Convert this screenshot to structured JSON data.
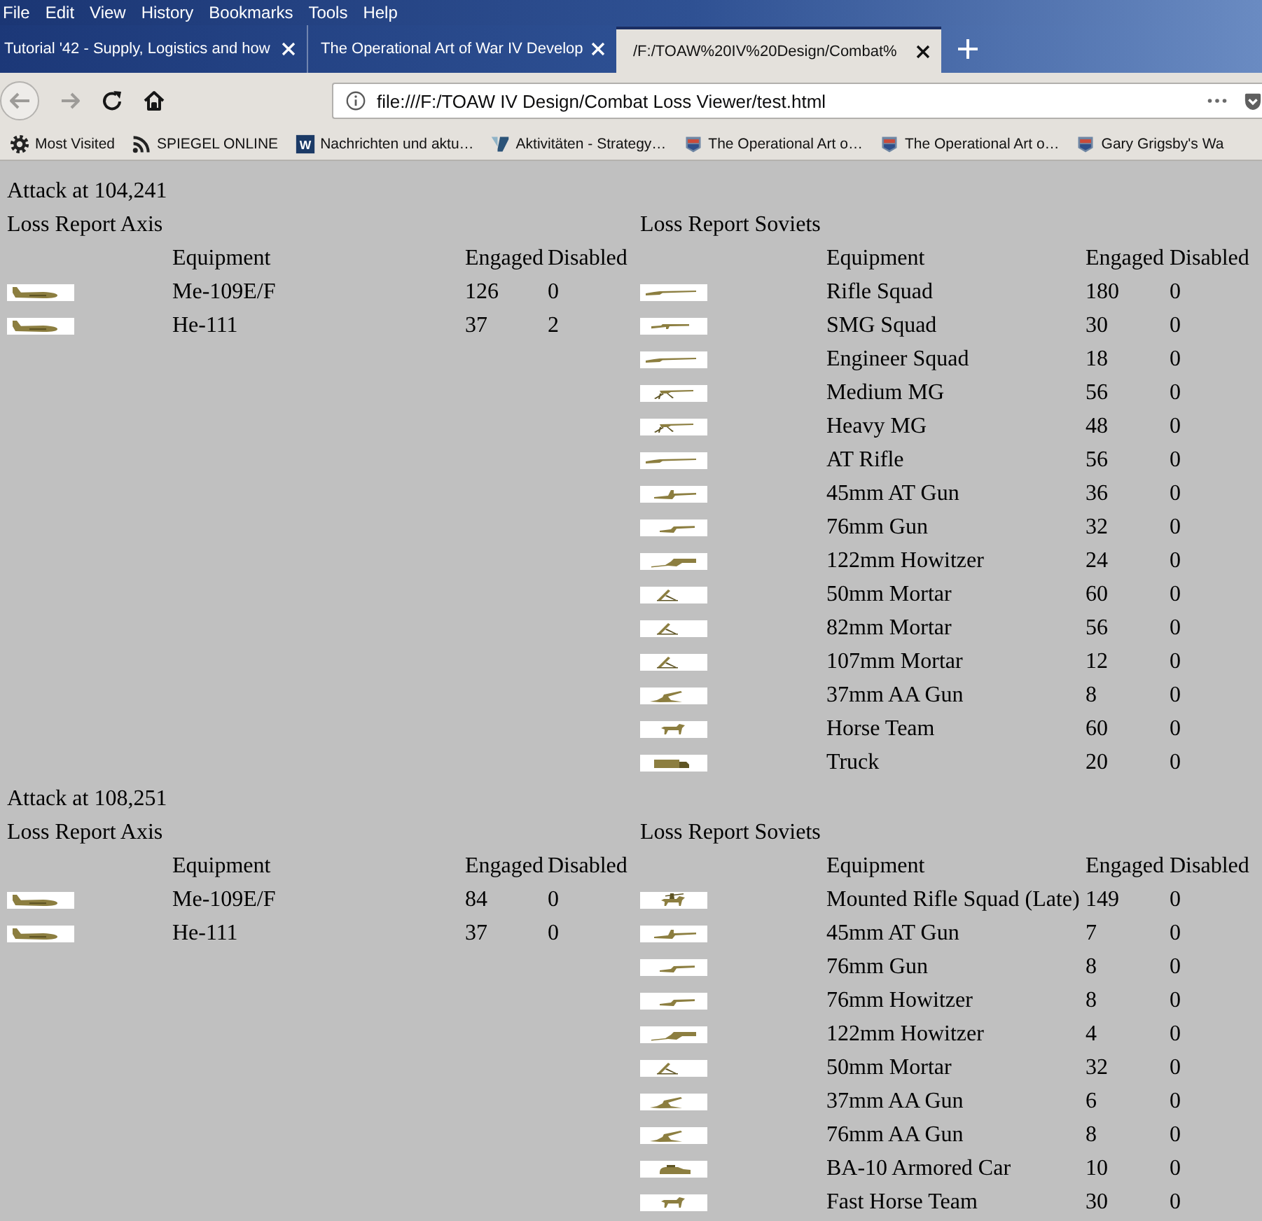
{
  "menu_bar": [
    "File",
    "Edit",
    "View",
    "History",
    "Bookmarks",
    "Tools",
    "Help"
  ],
  "tabs": [
    {
      "title": "Tutorial '42 - Supply, Logistics and how",
      "selected": false
    },
    {
      "title": "The Operational Art of War IV Develop",
      "selected": false
    },
    {
      "title": "/F:/TOAW%20IV%20Design/Combat%",
      "selected": true
    }
  ],
  "nav_buttons": [
    {
      "kind": "back",
      "disabled": true
    },
    {
      "kind": "forward",
      "disabled": true
    },
    {
      "kind": "reload",
      "disabled": false
    },
    {
      "kind": "home",
      "disabled": false
    }
  ],
  "address_bar": {
    "value": "file:///F:/TOAW IV Design/Combat Loss Viewer/test.html"
  },
  "bookmarks": [
    {
      "kind": "gear",
      "label": "Most Visited"
    },
    {
      "kind": "feed",
      "label": "SPIEGEL ONLINE"
    },
    {
      "kind": "letter",
      "logo": "W",
      "label": "Nachrichten und aktu…"
    },
    {
      "kind": "tile",
      "label": "Aktivitäten - Strategy…"
    },
    {
      "kind": "crest",
      "label": "The Operational Art o…"
    },
    {
      "kind": "crest",
      "label": "The Operational Art o…"
    },
    {
      "kind": "crest",
      "label": "Gary Grigsby's Wa"
    }
  ],
  "attacks": [
    {
      "title": "Attack at 104,241",
      "reports": [
        {
          "title": "Loss Report Axis",
          "columns": [
            "Equipment",
            "Engaged",
            "Disabled"
          ],
          "rows": [
            {
              "kind": "plane",
              "equipment": "Me-109E/F",
              "engaged_count": "126",
              "disabled_count": "0"
            },
            {
              "kind": "plane",
              "equipment": "He-111",
              "engaged_count": "37",
              "disabled_count": "2"
            }
          ]
        },
        {
          "title": "Loss Report Soviets",
          "columns": [
            "Equipment",
            "Engaged",
            "Disabled"
          ],
          "rows": [
            {
              "kind": "rifle",
              "equipment": "Rifle Squad",
              "engaged_count": "180",
              "disabled_count": "0"
            },
            {
              "kind": "smg",
              "equipment": "SMG Squad",
              "engaged_count": "30",
              "disabled_count": "0"
            },
            {
              "kind": "rifle",
              "equipment": "Engineer Squad",
              "engaged_count": "18",
              "disabled_count": "0"
            },
            {
              "kind": "mg",
              "equipment": "Medium MG",
              "engaged_count": "56",
              "disabled_count": "0"
            },
            {
              "kind": "mg",
              "equipment": "Heavy MG",
              "engaged_count": "48",
              "disabled_count": "0"
            },
            {
              "kind": "rifle",
              "equipment": "AT Rifle",
              "engaged_count": "56",
              "disabled_count": "0"
            },
            {
              "kind": "atgun",
              "equipment": "45mm AT Gun",
              "engaged_count": "36",
              "disabled_count": "0"
            },
            {
              "kind": "gun",
              "equipment": "76mm Gun",
              "engaged_count": "32",
              "disabled_count": "0"
            },
            {
              "kind": "howitzer",
              "equipment": "122mm Howitzer",
              "engaged_count": "24",
              "disabled_count": "0"
            },
            {
              "kind": "mortar",
              "equipment": "50mm Mortar",
              "engaged_count": "60",
              "disabled_count": "0"
            },
            {
              "kind": "mortar",
              "equipment": "82mm Mortar",
              "engaged_count": "56",
              "disabled_count": "0"
            },
            {
              "kind": "mortar",
              "equipment": "107mm Mortar",
              "engaged_count": "12",
              "disabled_count": "0"
            },
            {
              "kind": "aagun",
              "equipment": "37mm AA Gun",
              "engaged_count": "8",
              "disabled_count": "0"
            },
            {
              "kind": "horse",
              "equipment": "Horse Team",
              "engaged_count": "60",
              "disabled_count": "0"
            },
            {
              "kind": "truck",
              "equipment": "Truck",
              "engaged_count": "20",
              "disabled_count": "0"
            }
          ]
        }
      ]
    },
    {
      "title": "Attack at 108,251",
      "reports": [
        {
          "title": "Loss Report Axis",
          "columns": [
            "Equipment",
            "Engaged",
            "Disabled"
          ],
          "rows": [
            {
              "kind": "plane",
              "equipment": "Me-109E/F",
              "engaged_count": "84",
              "disabled_count": "0"
            },
            {
              "kind": "plane",
              "equipment": "He-111",
              "engaged_count": "37",
              "disabled_count": "0"
            }
          ]
        },
        {
          "title": "Loss Report Soviets",
          "columns": [
            "Equipment",
            "Engaged",
            "Disabled"
          ],
          "rows": [
            {
              "kind": "cavalry",
              "equipment": "Mounted Rifle Squad (Late)",
              "engaged_count": "149",
              "disabled_count": "0"
            },
            {
              "kind": "atgun",
              "equipment": "45mm AT Gun",
              "engaged_count": "7",
              "disabled_count": "0"
            },
            {
              "kind": "gun",
              "equipment": "76mm Gun",
              "engaged_count": "8",
              "disabled_count": "0"
            },
            {
              "kind": "gun",
              "equipment": "76mm Howitzer",
              "engaged_count": "8",
              "disabled_count": "0"
            },
            {
              "kind": "howitzer",
              "equipment": "122mm Howitzer",
              "engaged_count": "4",
              "disabled_count": "0"
            },
            {
              "kind": "mortar",
              "equipment": "50mm Mortar",
              "engaged_count": "32",
              "disabled_count": "0"
            },
            {
              "kind": "aagun",
              "equipment": "37mm AA Gun",
              "engaged_count": "6",
              "disabled_count": "0"
            },
            {
              "kind": "aagun",
              "equipment": "76mm AA Gun",
              "engaged_count": "8",
              "disabled_count": "0"
            },
            {
              "kind": "armoredcar",
              "equipment": "BA-10 Armored Car",
              "engaged_count": "10",
              "disabled_count": "0"
            },
            {
              "kind": "horse",
              "equipment": "Fast Horse Team",
              "engaged_count": "30",
              "disabled_count": "0"
            }
          ]
        }
      ]
    }
  ]
}
